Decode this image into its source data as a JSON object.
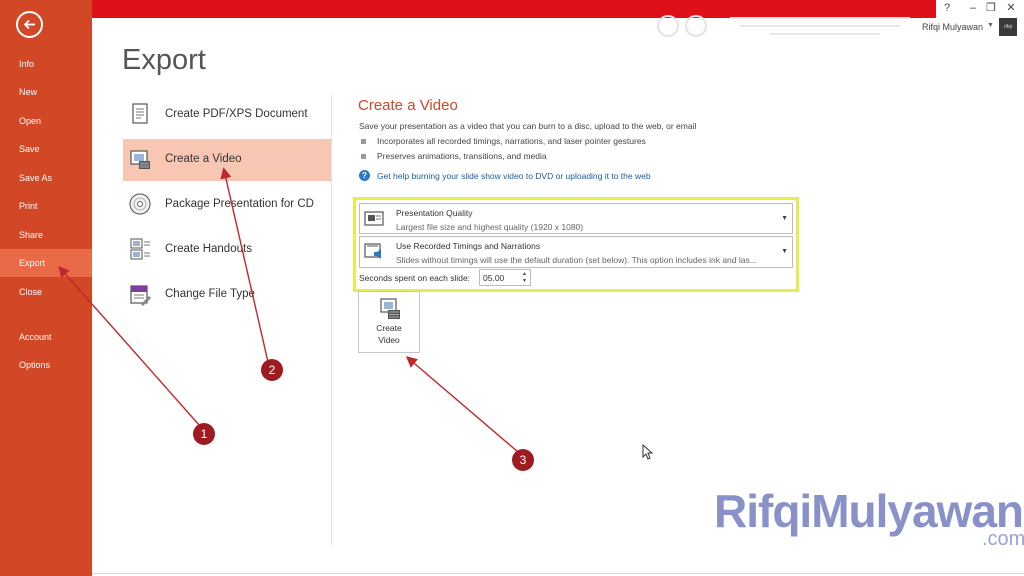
{
  "sidebar": {
    "items": [
      {
        "label": "Info"
      },
      {
        "label": "New"
      },
      {
        "label": "Open"
      },
      {
        "label": "Save"
      },
      {
        "label": "Save As"
      },
      {
        "label": "Print"
      },
      {
        "label": "Share"
      },
      {
        "label": "Export",
        "active": true
      },
      {
        "label": "Close"
      },
      {
        "label": "Account"
      },
      {
        "label": "Options"
      }
    ]
  },
  "titlebar": {
    "help": "?",
    "minimize": "–",
    "restore": "❐",
    "close": "✕",
    "user_name": "Rifqi Mulyawan",
    "user_caret": "▼",
    "avatar_text": "rifqi"
  },
  "page_title": "Export",
  "export_options": [
    {
      "label": "Create PDF/XPS Document",
      "icon": "pdf-document-icon"
    },
    {
      "label": "Create a Video",
      "icon": "video-icon",
      "selected": true
    },
    {
      "label": "Package Presentation for CD",
      "icon": "cd-icon"
    },
    {
      "label": "Create Handouts",
      "icon": "handouts-icon"
    },
    {
      "label": "Change File Type",
      "icon": "file-type-icon"
    }
  ],
  "video_panel": {
    "title": "Create a Video",
    "description": "Save your presentation as a video that you can burn to a disc, upload to the web, or email",
    "bullets": [
      "Incorporates all recorded timings, narrations, and laser pointer gestures",
      "Preserves animations, transitions, and media"
    ],
    "help_link": "Get help burning your slide show video to DVD or uploading it to the web",
    "quality": {
      "title": "Presentation Quality",
      "subtitle": "Largest file size and highest quality (1920 x 1080)"
    },
    "timings": {
      "title": "Use Recorded Timings and Narrations",
      "subtitle": "Slides without timings will use the default duration (set below). This option includes ink and las..."
    },
    "seconds_label": "Seconds spent on each slide:",
    "seconds_value": "05.00",
    "create_button": {
      "line1": "Create",
      "line2": "Video"
    }
  },
  "annotations": {
    "steps": [
      "1",
      "2",
      "3"
    ],
    "color": "#9e1b22"
  },
  "watermark": {
    "text": "RifqiMulyawan",
    "suffix": ".com"
  },
  "colors": {
    "accent": "#d24726",
    "topbar": "#e0101a",
    "selected": "#f8c7b3",
    "highlight": "#e4ef47"
  }
}
